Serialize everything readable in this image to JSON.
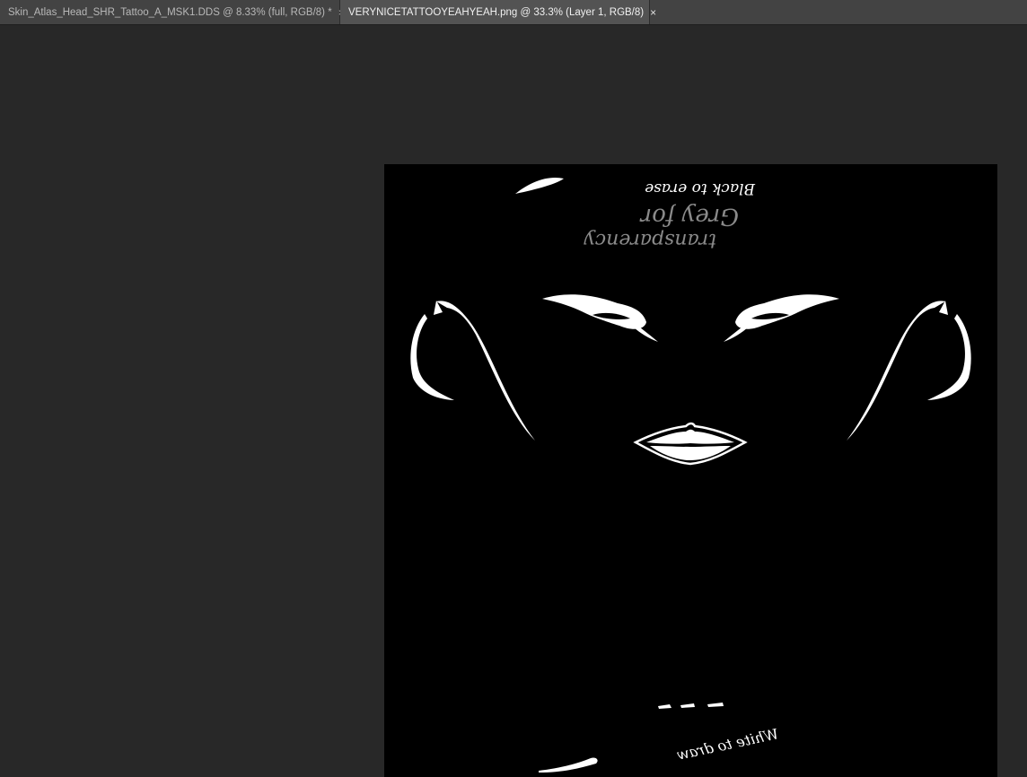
{
  "tabs": [
    {
      "label": "Skin_Atlas_Head_SHR_Tattoo_A_MSK1.DDS @ 8.33% (full, RGB/8) *",
      "close_glyph": "×",
      "active": false
    },
    {
      "label": "VERYNICETATTOOYEAHYEAH.png @ 33.3% (Layer 1, RGB/8)",
      "close_glyph": "×",
      "active": true
    }
  ],
  "canvas": {
    "annotations": {
      "black_line": "Black to erase",
      "grey_line_1": "Grey for",
      "grey_line_2": "transparency",
      "white_line_1": "White to draw"
    },
    "colors": {
      "background": "#000000",
      "paint": "#ffffff",
      "grey_text": "#8a8a8a"
    }
  },
  "colors": {
    "workspace": "#282828",
    "tabbar": "#434343",
    "tab_active": "#535353"
  }
}
